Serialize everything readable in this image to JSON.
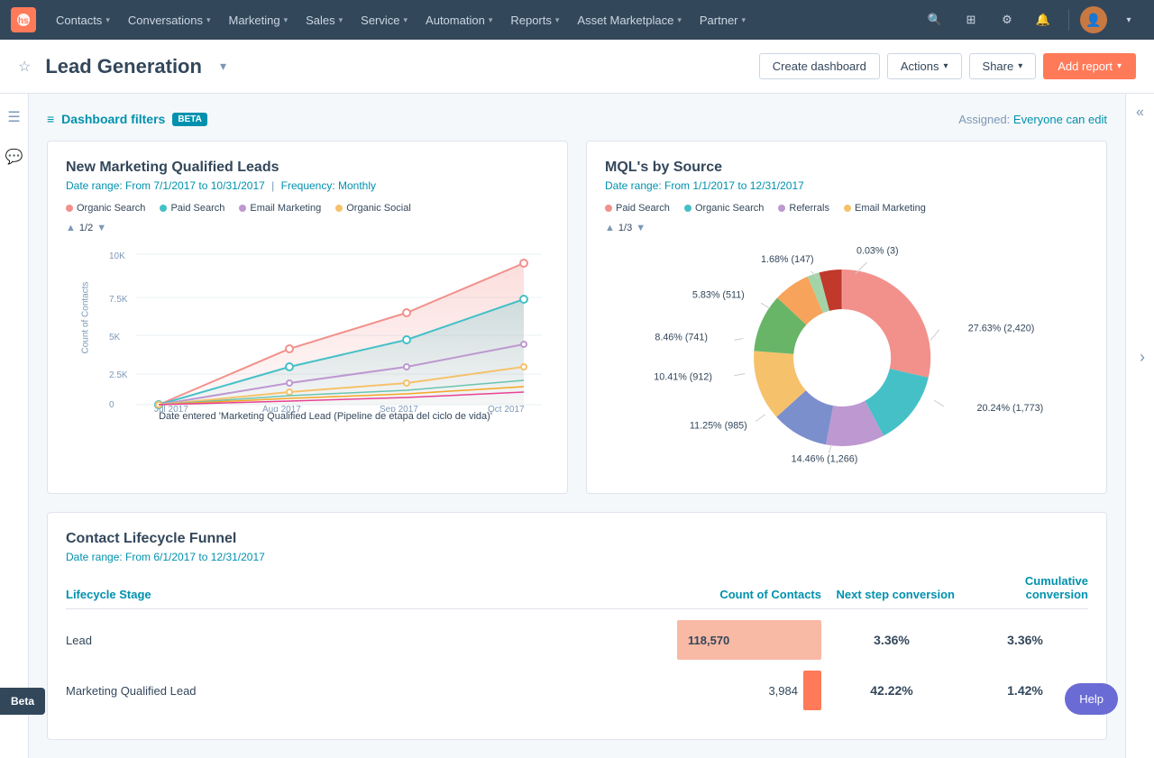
{
  "nav": {
    "items": [
      {
        "label": "Contacts",
        "id": "contacts"
      },
      {
        "label": "Conversations",
        "id": "conversations"
      },
      {
        "label": "Marketing",
        "id": "marketing"
      },
      {
        "label": "Sales",
        "id": "sales"
      },
      {
        "label": "Service",
        "id": "service"
      },
      {
        "label": "Automation",
        "id": "automation"
      },
      {
        "label": "Reports",
        "id": "reports"
      },
      {
        "label": "Asset Marketplace",
        "id": "asset-marketplace"
      },
      {
        "label": "Partner",
        "id": "partner"
      }
    ]
  },
  "subheader": {
    "title": "Lead Generation",
    "create_dashboard": "Create dashboard",
    "actions": "Actions",
    "share": "Share",
    "add_report": "Add report"
  },
  "filters": {
    "label": "Dashboard filters",
    "badge": "BETA",
    "assigned_label": "Assigned:",
    "assigned_value": "Everyone can edit"
  },
  "mql_chart": {
    "title": "New Marketing Qualified Leads",
    "date_range": "Date range: From 7/1/2017 to 10/31/2017",
    "frequency": "Frequency: Monthly",
    "legend": [
      {
        "label": "Organic Search",
        "color": "#f2918c"
      },
      {
        "label": "Paid Search",
        "color": "#45c0c7"
      },
      {
        "label": "Email Marketing",
        "color": "#be98d1"
      },
      {
        "label": "Organic Social",
        "color": "#f5c26b"
      }
    ],
    "pagination": "1/2",
    "y_label": "Count of Contacts",
    "x_labels": [
      "Jul 2017",
      "Aug 2017",
      "Sep 2017",
      "Oct 2017"
    ],
    "x_axis_label": "Date entered 'Marketing Qualified Lead (Pipeline de etapa del ciclo de vida)'"
  },
  "mql_source": {
    "title": "MQL's by Source",
    "date_range": "Date range: From 1/1/2017 to 12/31/2017",
    "legend": [
      {
        "label": "Paid Search",
        "color": "#f2918c"
      },
      {
        "label": "Organic Search",
        "color": "#45c0c7"
      },
      {
        "label": "Referrals",
        "color": "#be98d1"
      },
      {
        "label": "Email Marketing",
        "color": "#f5c26b"
      }
    ],
    "pagination": "1/3",
    "segments": [
      {
        "label": "27.63% (2,420)",
        "color": "#f2918c",
        "value": 27.63
      },
      {
        "label": "20.24% (1,773)",
        "color": "#45c0c7",
        "value": 20.24
      },
      {
        "label": "14.46% (1,266)",
        "color": "#be98d1",
        "value": 14.46
      },
      {
        "label": "11.25% (985)",
        "color": "#7b8fcd",
        "value": 11.25
      },
      {
        "label": "10.41% (912)",
        "color": "#f5c26b",
        "value": 10.41
      },
      {
        "label": "8.46% (741)",
        "color": "#68b568",
        "value": 8.46
      },
      {
        "label": "5.83% (511)",
        "color": "#f7a35c",
        "value": 5.83
      },
      {
        "label": "1.68% (147)",
        "color": "#a3d4a8",
        "value": 1.68
      },
      {
        "label": "0.03% (3)",
        "color": "#c0392b",
        "value": 0.03
      }
    ]
  },
  "funnel": {
    "title": "Contact Lifecycle Funnel",
    "date_range": "Date range: From 6/1/2017 to 12/31/2017",
    "headers": {
      "stage": "Lifecycle Stage",
      "count": "Count of Contacts",
      "next_step": "Next step conversion",
      "cumulative": "Cumulative conversion"
    },
    "rows": [
      {
        "stage": "Lead",
        "count": 118570,
        "count_display": "118,570",
        "bar_width_pct": 100,
        "next_conversion": "3.36%",
        "cumulative_conversion": "3.36%"
      },
      {
        "stage": "Marketing Qualified Lead",
        "count": 3984,
        "count_display": "3,984",
        "bar_width_pct": 3.36,
        "next_conversion": "42.22%",
        "cumulative_conversion": "1.42%"
      }
    ]
  }
}
